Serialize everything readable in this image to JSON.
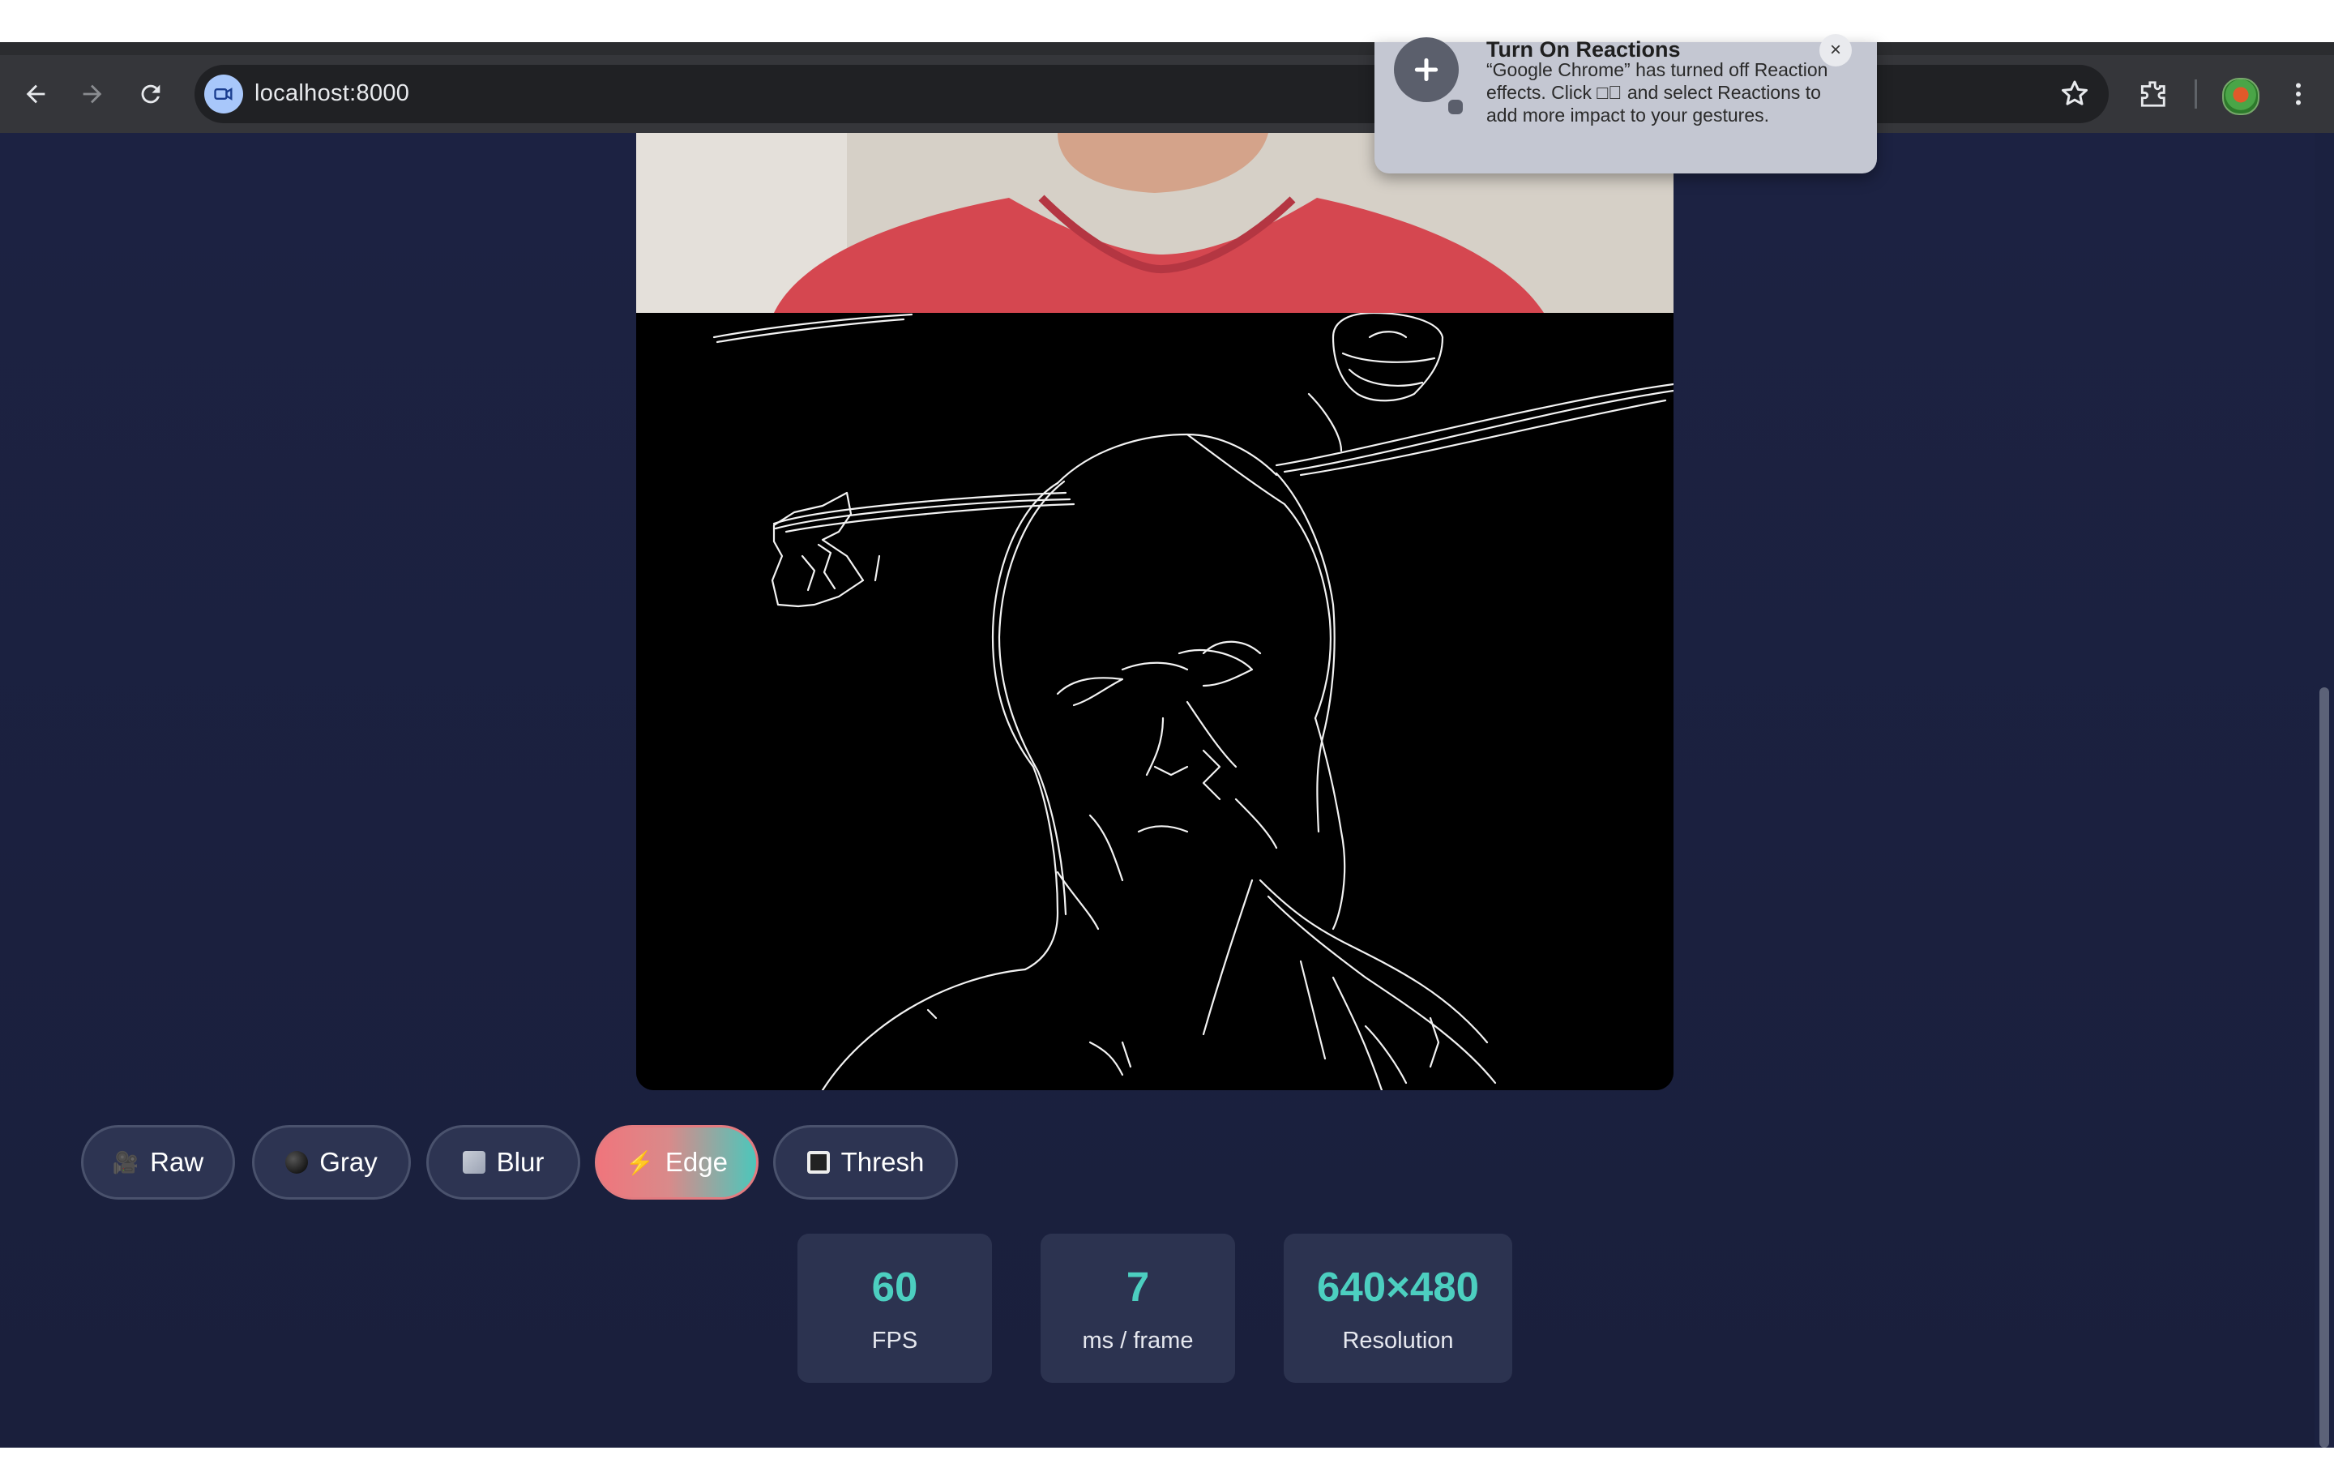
{
  "browser": {
    "url": "localhost:8000",
    "icons": [
      "back-icon",
      "forward-icon",
      "reload-icon",
      "camera-icon",
      "star-icon",
      "extensions-icon",
      "profile-avatar",
      "more-menu-icon"
    ]
  },
  "popup": {
    "title": "Turn On Reactions",
    "body": "“Google Chrome” has turned off Reaction effects. Click □⃤ and select Reactions to add more impact to your gestures.",
    "close": "×"
  },
  "filters": [
    {
      "icon": "🎥",
      "label": "Raw",
      "active": false
    },
    {
      "icon": "⚫",
      "label": "Gray",
      "active": false
    },
    {
      "icon": "🌫️",
      "label": "Blur",
      "active": false
    },
    {
      "icon": "⚡",
      "label": "Edge",
      "active": true
    },
    {
      "icon": "🔲",
      "label": "Thresh",
      "active": false
    }
  ],
  "stats": [
    {
      "value": "60",
      "label": "FPS"
    },
    {
      "value": "7",
      "label": "ms / frame"
    },
    {
      "value": "640×480",
      "label": "Resolution"
    }
  ],
  "colors": {
    "page_bg": "#1b2140",
    "accent_teal": "#4ccfc0",
    "accent_coral": "#f0757c",
    "button_bg": "#2d3452"
  }
}
